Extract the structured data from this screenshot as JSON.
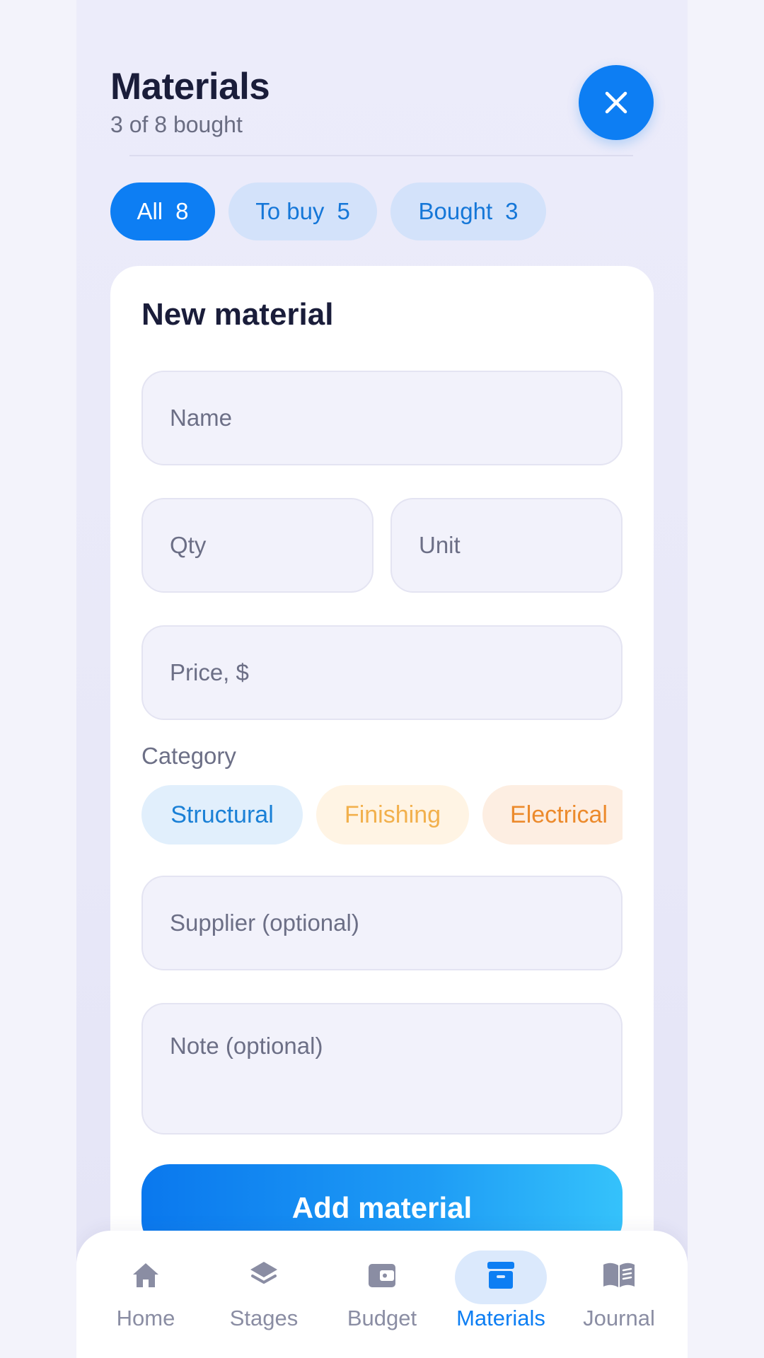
{
  "header": {
    "title": "Materials",
    "subtitle": "3 of 8 bought",
    "close_icon": "close-icon"
  },
  "filters": [
    {
      "label": "All",
      "count": "8",
      "active": true
    },
    {
      "label": "To buy",
      "count": "5",
      "active": false
    },
    {
      "label": "Bought",
      "count": "3",
      "active": false
    }
  ],
  "form": {
    "title": "New material",
    "name_placeholder": "Name",
    "qty_placeholder": "Qty",
    "unit_placeholder": "Unit",
    "price_placeholder": "Price, $",
    "category_label": "Category",
    "categories": [
      {
        "label": "Structural",
        "color": "#1a80d6",
        "bg": "#e1effc"
      },
      {
        "label": "Finishing",
        "color": "#f2b04c",
        "bg": "#fff4e4"
      },
      {
        "label": "Electrical",
        "color": "#ec8a2c",
        "bg": "#fdeee2"
      }
    ],
    "supplier_placeholder": "Supplier (optional)",
    "note_placeholder": "Note (optional)",
    "submit_label": "Add material"
  },
  "nav": {
    "items": [
      {
        "label": "Home",
        "icon": "home-icon",
        "active": false
      },
      {
        "label": "Stages",
        "icon": "layers-icon",
        "active": false
      },
      {
        "label": "Budget",
        "icon": "wallet-icon",
        "active": false
      },
      {
        "label": "Materials",
        "icon": "archive-box-icon",
        "active": true
      },
      {
        "label": "Journal",
        "icon": "book-icon",
        "active": false
      }
    ]
  },
  "colors": {
    "accent": "#0d7ef3",
    "title": "#1a1d3a",
    "muted": "#6c6f86"
  }
}
